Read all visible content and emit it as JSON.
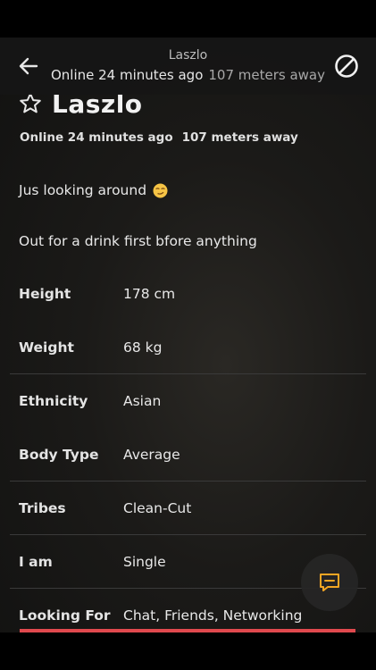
{
  "topbar": {
    "name": "Laszlo",
    "online": "Online 24 minutes ago",
    "distance": "107 meters away",
    "back_icon": "arrow-left-icon",
    "block_icon": "block-icon"
  },
  "profile": {
    "name": "Laszlo",
    "favorite_icon": "star-outline-icon",
    "online": "Online 24 minutes ago",
    "distance": "107 meters away",
    "headline": "Jus looking around",
    "headline_emoji": "smirking-face-emoji",
    "about": "Out for a drink first bfore anything"
  },
  "stats": [
    {
      "label": "Height",
      "value": "178 cm"
    },
    {
      "label": "Weight",
      "value": "68 kg"
    },
    {
      "label": "Ethnicity",
      "value": "Asian"
    },
    {
      "label": "Body Type",
      "value": "Average"
    },
    {
      "label": "Tribes",
      "value": "Clean-Cut"
    },
    {
      "label": "I am",
      "value": "Single"
    },
    {
      "label": "Looking For",
      "value": "Chat, Friends, Networking"
    }
  ],
  "chat_button": {
    "icon": "chat-bubble-icon"
  },
  "photo_progress": {
    "fraction": 1.0
  },
  "colors": {
    "accent": "#f5a623",
    "progress": "#e0494e"
  }
}
